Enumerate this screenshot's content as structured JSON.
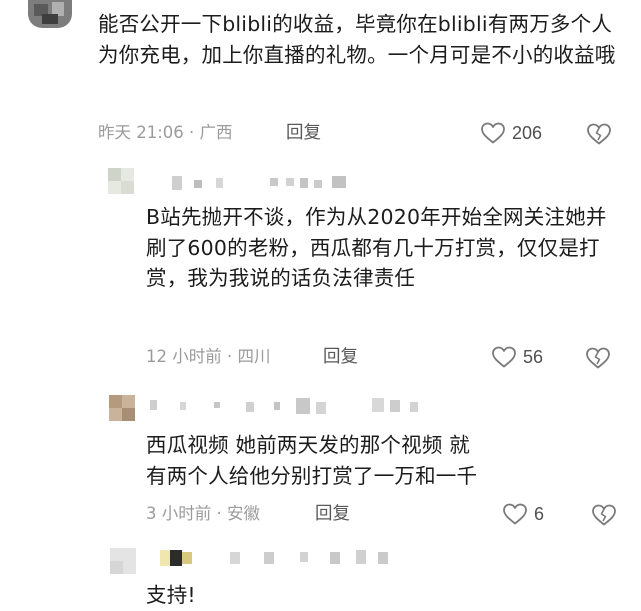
{
  "comments": [
    {
      "text": "能否公开一下blibli的收益，毕竟你在blibli有两万多个人为你充电，加上你直播的礼物。一个月可是不小的收益哦",
      "time": "昨天 21:06",
      "location": "广西",
      "reply_label": "回复",
      "likes": "206"
    },
    {
      "text": "B站先抛开不谈，作为从2020年开始全网关注她并刷了600的老粉，西瓜都有几十万打赏，仅仅是打赏，我为我说的话负法律责任",
      "time": "12 小时前",
      "location": "四川",
      "reply_label": "回复",
      "likes": "56"
    },
    {
      "text": "西瓜视频 她前两天发的那个视频 就有两个人给他分别打赏了一万和一千",
      "time": "3 小时前",
      "location": "安徽",
      "reply_label": "回复",
      "likes": "6"
    },
    {
      "text": "支持!"
    }
  ],
  "colors": {
    "meta": "#9b9b9b",
    "text": "#1c1c1c",
    "icon": "#7a7a7a"
  }
}
